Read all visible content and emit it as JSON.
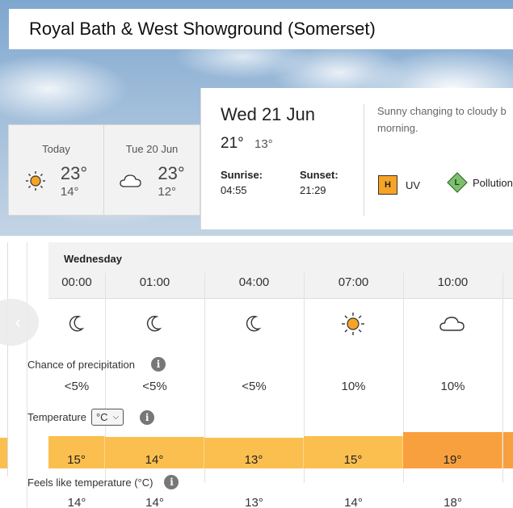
{
  "location": {
    "title": "Royal Bath & West Showground (Somerset)"
  },
  "days": [
    {
      "label": "Today",
      "icon": "sun-icon",
      "high": "23°",
      "low": "14°"
    },
    {
      "label": "Tue 20 Jun",
      "icon": "cloud-icon",
      "high": "23°",
      "low": "12°"
    }
  ],
  "selected_day": {
    "date": "Wed 21 Jun",
    "high": "21°",
    "low": "13°",
    "sunrise_label": "Sunrise:",
    "sunrise": "04:55",
    "sunset_label": "Sunset:",
    "sunset": "21:29",
    "summary_line1": "Sunny changing to cloudy b",
    "summary_line2": "morning.",
    "uv_badge": "H",
    "uv_label": "UV",
    "pollution_badge": "L",
    "pollution_label": "Pollution"
  },
  "timeline": {
    "day_label": "Wednesday",
    "precip_label": "Chance of precipitation",
    "temp_label": "Temperature",
    "temp_unit": "°C",
    "feels_label": "Feels like temperature (°C)",
    "info_glyph": "i",
    "hours": [
      {
        "time": "00:00",
        "icon": "moon-icon",
        "precip": "<5%",
        "temp": "15°",
        "temp_level": 15,
        "feels": "14°"
      },
      {
        "time": "01:00",
        "icon": "moon-icon",
        "precip": "<5%",
        "temp": "14°",
        "temp_level": 14,
        "feels": "14°"
      },
      {
        "time": "04:00",
        "icon": "moon-icon",
        "precip": "<5%",
        "temp": "13°",
        "temp_level": 13,
        "feels": "13°"
      },
      {
        "time": "07:00",
        "icon": "sun-icon",
        "precip": "10%",
        "temp": "15°",
        "temp_level": 15,
        "feels": "14°"
      },
      {
        "time": "10:00",
        "icon": "cloud-icon",
        "precip": "10%",
        "temp": "19°",
        "temp_level": 19,
        "feels": "18°"
      }
    ]
  },
  "colors": {
    "temp_warm": "#fbbf4f",
    "temp_warmer": "#f9a03e",
    "uv_high": "#f7a326",
    "pollution_low": "#7cc06d"
  }
}
